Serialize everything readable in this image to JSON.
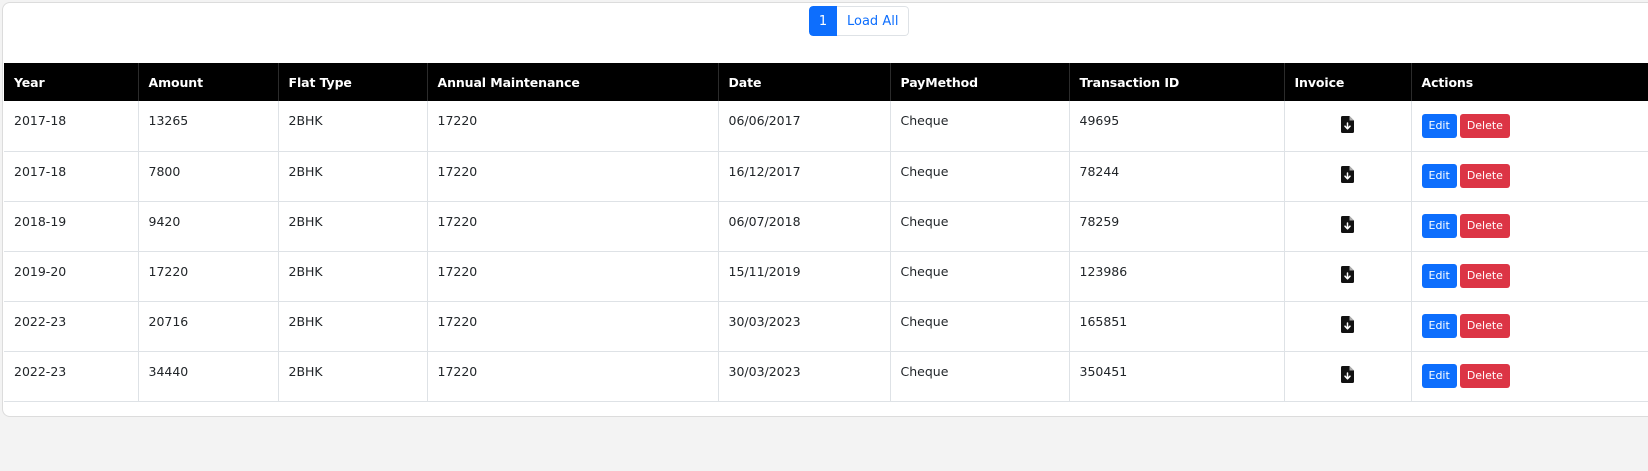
{
  "pagination": {
    "current_page": "1",
    "load_all_label": "Load All"
  },
  "table": {
    "headers": [
      "Year",
      "Amount",
      "Flat Type",
      "Annual Maintenance",
      "Date",
      "PayMethod",
      "Transaction ID",
      "Invoice",
      "Actions"
    ],
    "rows": [
      {
        "year": "2017-18",
        "amount": "13265",
        "flat_type": "2BHK",
        "annual_maintenance": "17220",
        "date": "06/06/2017",
        "pay_method": "Cheque",
        "transaction_id": "49695"
      },
      {
        "year": "2017-18",
        "amount": "7800",
        "flat_type": "2BHK",
        "annual_maintenance": "17220",
        "date": "16/12/2017",
        "pay_method": "Cheque",
        "transaction_id": "78244"
      },
      {
        "year": "2018-19",
        "amount": "9420",
        "flat_type": "2BHK",
        "annual_maintenance": "17220",
        "date": "06/07/2018",
        "pay_method": "Cheque",
        "transaction_id": "78259"
      },
      {
        "year": "2019-20",
        "amount": "17220",
        "flat_type": "2BHK",
        "annual_maintenance": "17220",
        "date": "15/11/2019",
        "pay_method": "Cheque",
        "transaction_id": "123986"
      },
      {
        "year": "2022-23",
        "amount": "20716",
        "flat_type": "2BHK",
        "annual_maintenance": "17220",
        "date": "30/03/2023",
        "pay_method": "Cheque",
        "transaction_id": "165851"
      },
      {
        "year": "2022-23",
        "amount": "34440",
        "flat_type": "2BHK",
        "annual_maintenance": "17220",
        "date": "30/03/2023",
        "pay_method": "Cheque",
        "transaction_id": "350451"
      }
    ],
    "invoice_icon": "file-download-icon",
    "edit_label": "Edit",
    "delete_label": "Delete"
  },
  "colors": {
    "header_bg": "#000000",
    "primary": "#0d6efd",
    "danger": "#dc3545",
    "page_bg": "#f3f3f3"
  }
}
